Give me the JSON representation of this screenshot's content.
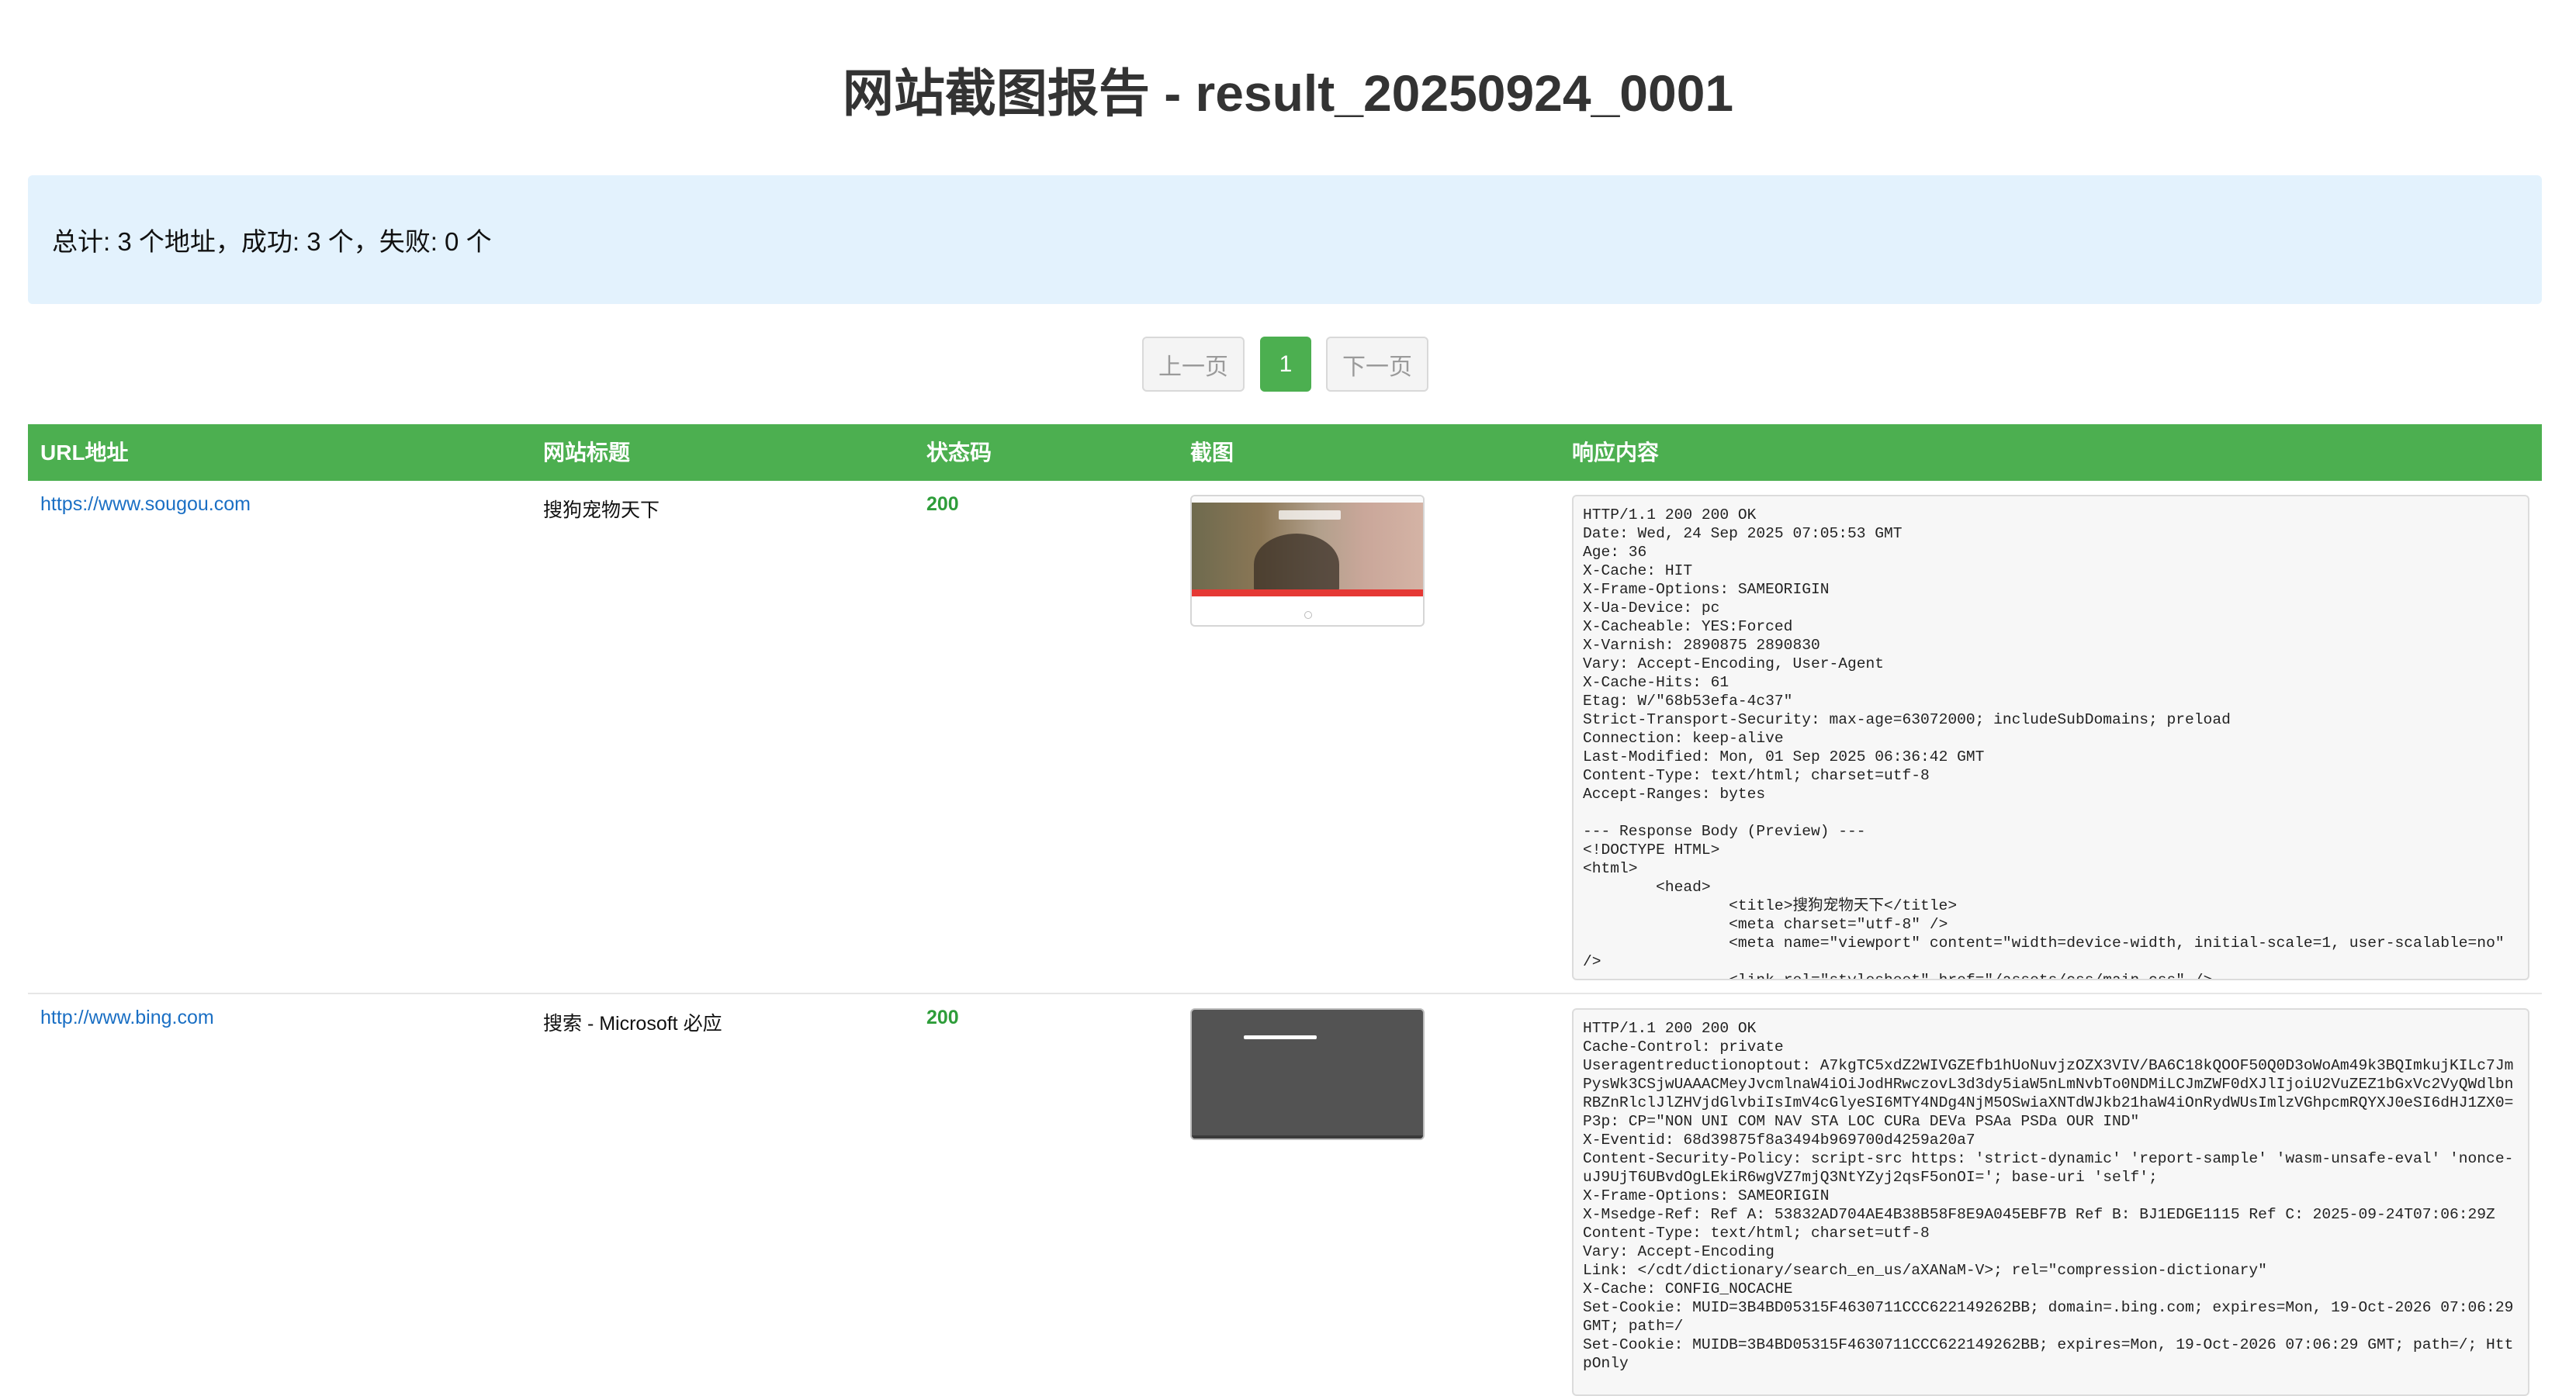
{
  "page_title": "网站截图报告 - result_20250924_0001",
  "summary_text": "总计: 3 个地址，成功: 3 个，失败: 0 个",
  "pagination": {
    "prev": "上一页",
    "current": "1",
    "next": "下一页"
  },
  "table": {
    "headers": {
      "url": "URL地址",
      "title": "网站标题",
      "status": "状态码",
      "screenshot": "截图",
      "response": "响应内容"
    },
    "rows": [
      {
        "url": "https://www.sougou.com",
        "title": "搜狗宠物天下",
        "status": "200",
        "response": "HTTP/1.1 200 200 OK\nDate: Wed, 24 Sep 2025 07:05:53 GMT\nAge: 36\nX-Cache: HIT\nX-Frame-Options: SAMEORIGIN\nX-Ua-Device: pc\nX-Cacheable: YES:Forced\nX-Varnish: 2890875 2890830\nVary: Accept-Encoding, User-Agent\nX-Cache-Hits: 61\nEtag: W/\"68b53efa-4c37\"\nStrict-Transport-Security: max-age=63072000; includeSubDomains; preload\nConnection: keep-alive\nLast-Modified: Mon, 01 Sep 2025 06:36:42 GMT\nContent-Type: text/html; charset=utf-8\nAccept-Ranges: bytes\n\n--- Response Body (Preview) ---\n<!DOCTYPE HTML>\n<html>\n        <head>\n                <title>搜狗宠物天下</title>\n                <meta charset=\"utf-8\" />\n                <meta name=\"viewport\" content=\"width=device-width, initial-scale=1, user-scalable=no\" />\n                <link rel=\"stylesheet\" href=\"/assets/css/main.css\" />"
      },
      {
        "url": "http://www.bing.com",
        "title": "搜索 - Microsoft 必应",
        "status": "200",
        "response": "HTTP/1.1 200 200 OK\nCache-Control: private\nUseragentreductionoptout: A7kgTC5xdZ2WIVGZEfb1hUoNuvjzOZX3VIV/BA6C18kQOOF50Q0D3oWoAm49k3BQImkujKILc7JmPysWk3CSjwUAAACMeyJvcmlnaW4iOiJodHRwczovL3d3dy5iaW5nLmNvbTo0NDMiLCJmZWF0dXJlIjoiU2VuZEZ1bGxVc2VyQWdlbnRBZnRlclJlZHVjdGlvbiIsImV4cGlyeSI6MTY4NDg4NjM5OSwiaXNTdWJkb21haW4iOnRydWUsImlzVGhpcmRQYXJ0eSI6dHJ1ZX0=\nP3p: CP=\"NON UNI COM NAV STA LOC CURa DEVa PSAa PSDa OUR IND\"\nX-Eventid: 68d39875f8a3494b969700d4259a20a7\nContent-Security-Policy: script-src https: 'strict-dynamic' 'report-sample' 'wasm-unsafe-eval' 'nonce-uJ9UjT6UBvdOgLEkiR6wgVZ7mjQ3NtYZyj2qsF5onOI='; base-uri 'self';\nX-Frame-Options: SAMEORIGIN\nX-Msedge-Ref: Ref A: 53832AD704AE4B38B58F8E9A045EBF7B Ref B: BJ1EDGE1115 Ref C: 2025-09-24T07:06:29Z\nContent-Type: text/html; charset=utf-8\nVary: Accept-Encoding\nLink: </cdt/dictionary/search_en_us/aXANaM-V>; rel=\"compression-dictionary\"\nX-Cache: CONFIG_NOCACHE\nSet-Cookie: MUID=3B4BD05315F4630711CCC622149262BB; domain=.bing.com; expires=Mon, 19-Oct-2026 07:06:29 GMT; path=/\nSet-Cookie: MUIDB=3B4BD05315F4630711CCC622149262BB; expires=Mon, 19-Oct-2026 07:06:29 GMT; path=/; HttpOnly"
      }
    ]
  }
}
